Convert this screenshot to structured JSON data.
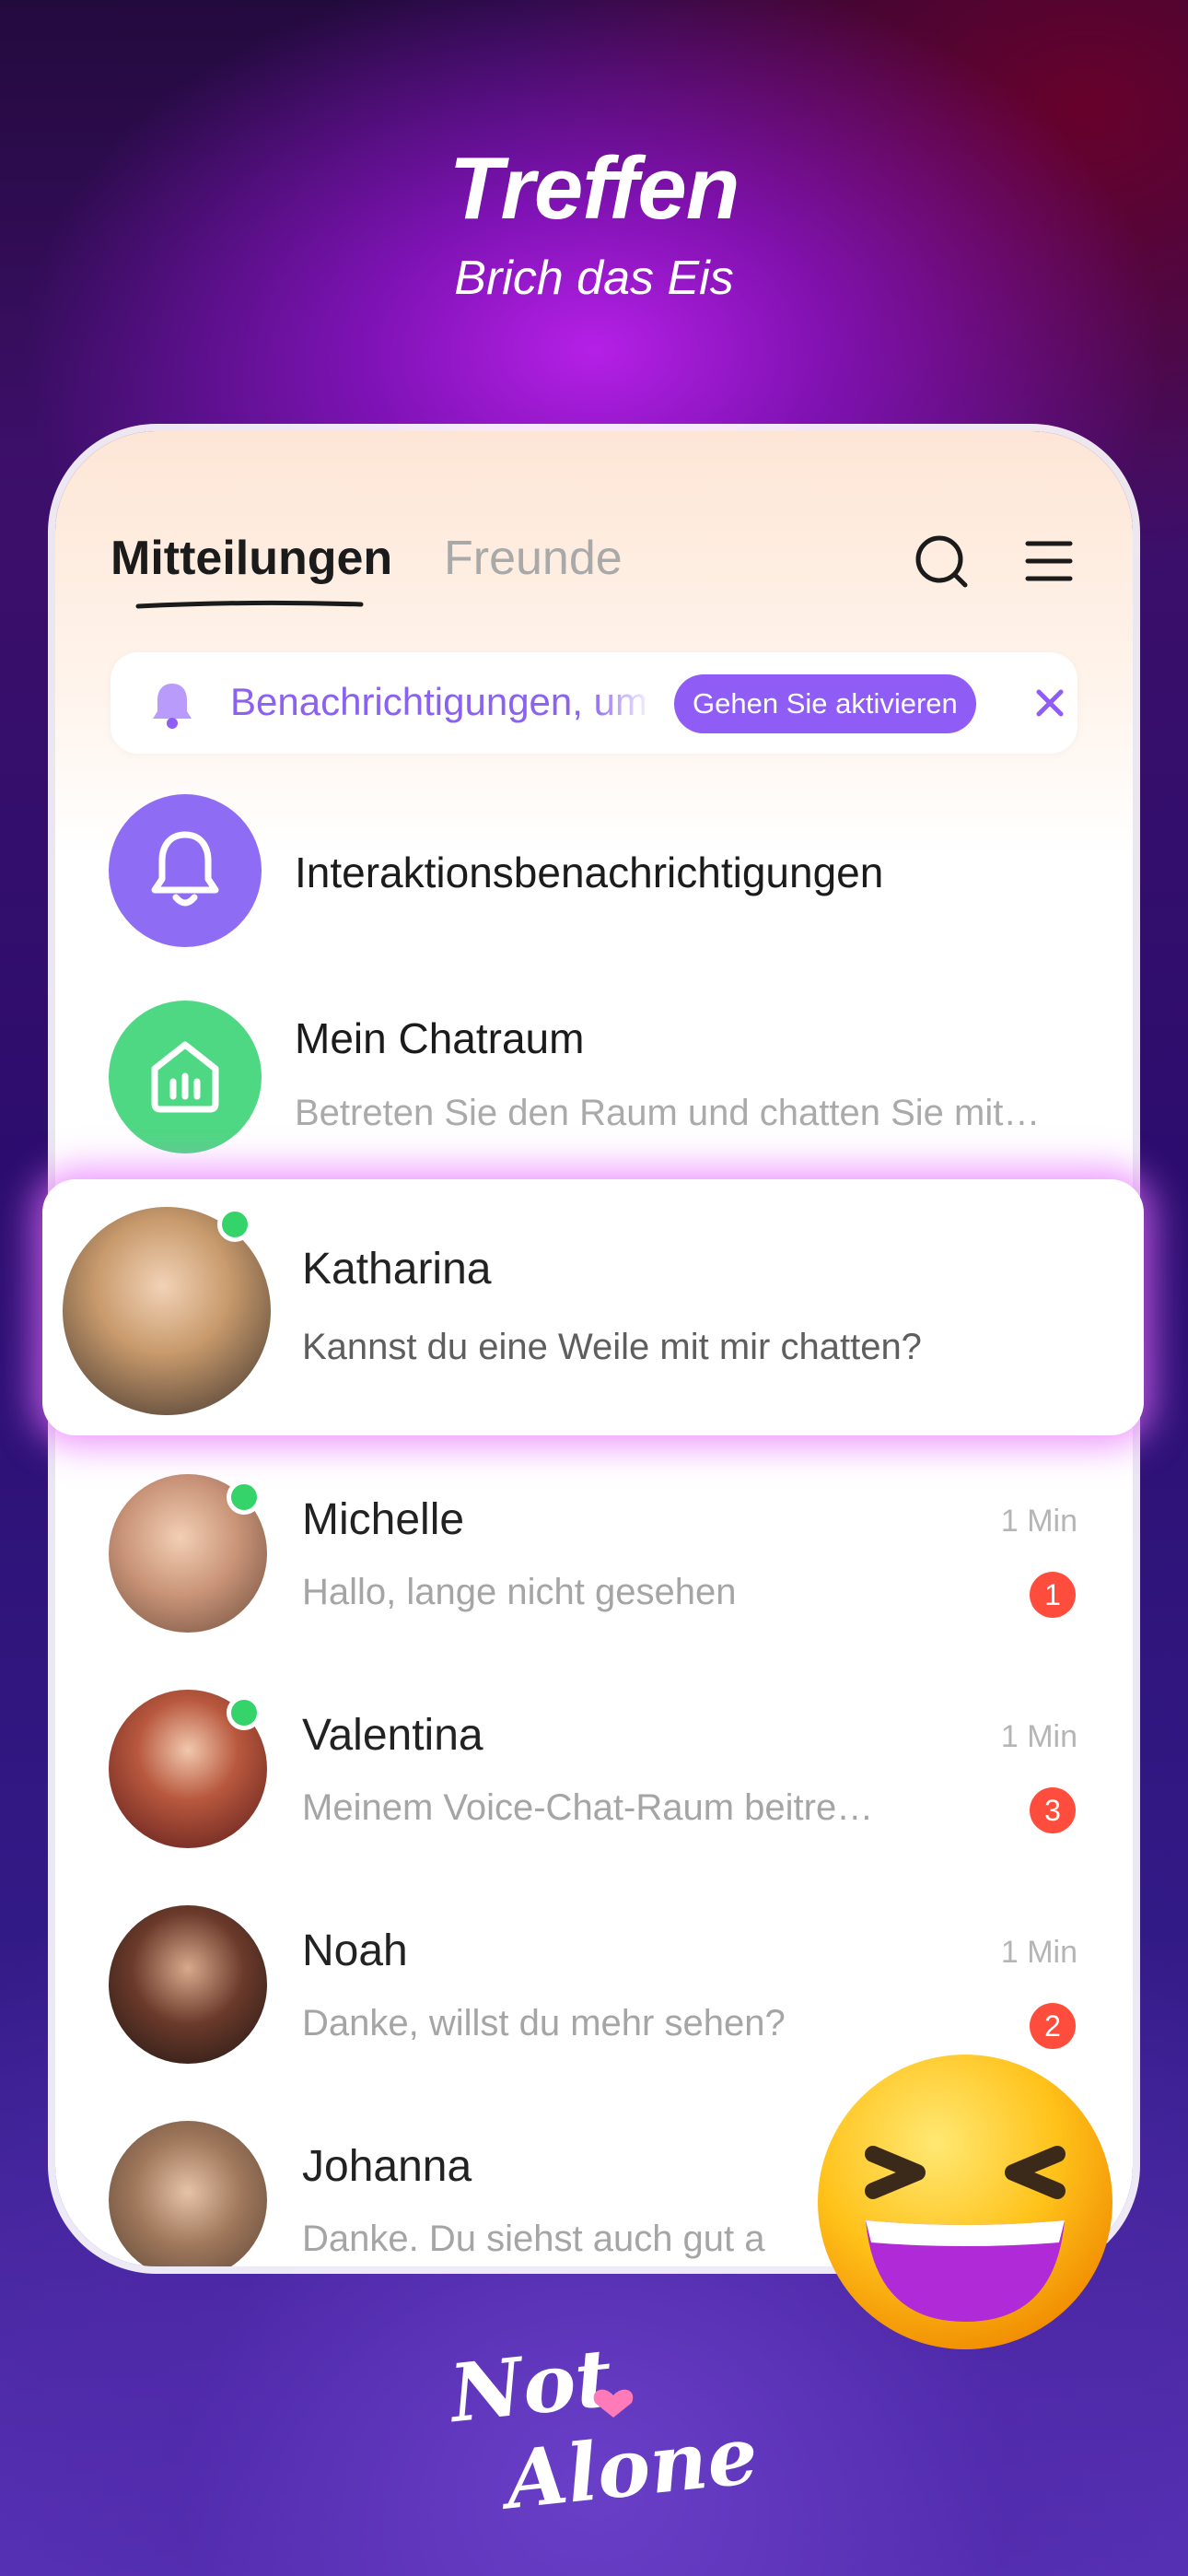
{
  "header": {
    "title": "Treffen",
    "subtitle": "Brich das Eis"
  },
  "tabs": [
    {
      "label": "Mitteilungen",
      "active": true
    },
    {
      "label": "Freunde",
      "active": false
    }
  ],
  "toolbar_icons": [
    "search-icon",
    "menu-icon"
  ],
  "notification_banner": {
    "text": "Benachrichtigungen, um",
    "button_label": "Gehen Sie aktivieren",
    "icon": "bell-icon",
    "close_icon": "close-icon"
  },
  "system_items": [
    {
      "title": "Interaktionsbenachrichtigungen",
      "icon": "bell-icon",
      "color": "#8f6cf4"
    },
    {
      "title": "Mein Chatraum",
      "subtitle": "Betreten Sie den Raum und chatten Sie mit…",
      "icon": "chatroom-icon",
      "color": "#4fd883"
    }
  ],
  "featured_chat": {
    "name": "Katharina",
    "message": "Kannst du eine Weile mit mir chatten?",
    "online": true
  },
  "chats": [
    {
      "name": "Michelle",
      "message": "Hallo, lange nicht gesehen",
      "time": "1 Min",
      "unread": "1",
      "online": true
    },
    {
      "name": "Valentina",
      "message": "Meinem Voice-Chat-Raum beitre…",
      "time": "1 Min",
      "unread": "3",
      "online": true
    },
    {
      "name": "Noah",
      "message": "Danke, willst du mehr sehen?",
      "time": "1 Min",
      "unread": "2",
      "online": false
    },
    {
      "name": "Johanna",
      "message": "Danke. Du siehst auch gut a",
      "online": false
    }
  ],
  "brand": {
    "logo_text": "Not Alone",
    "accent": "#ff7ab8"
  },
  "decoration": {
    "emoji": "laughing-emoji"
  }
}
